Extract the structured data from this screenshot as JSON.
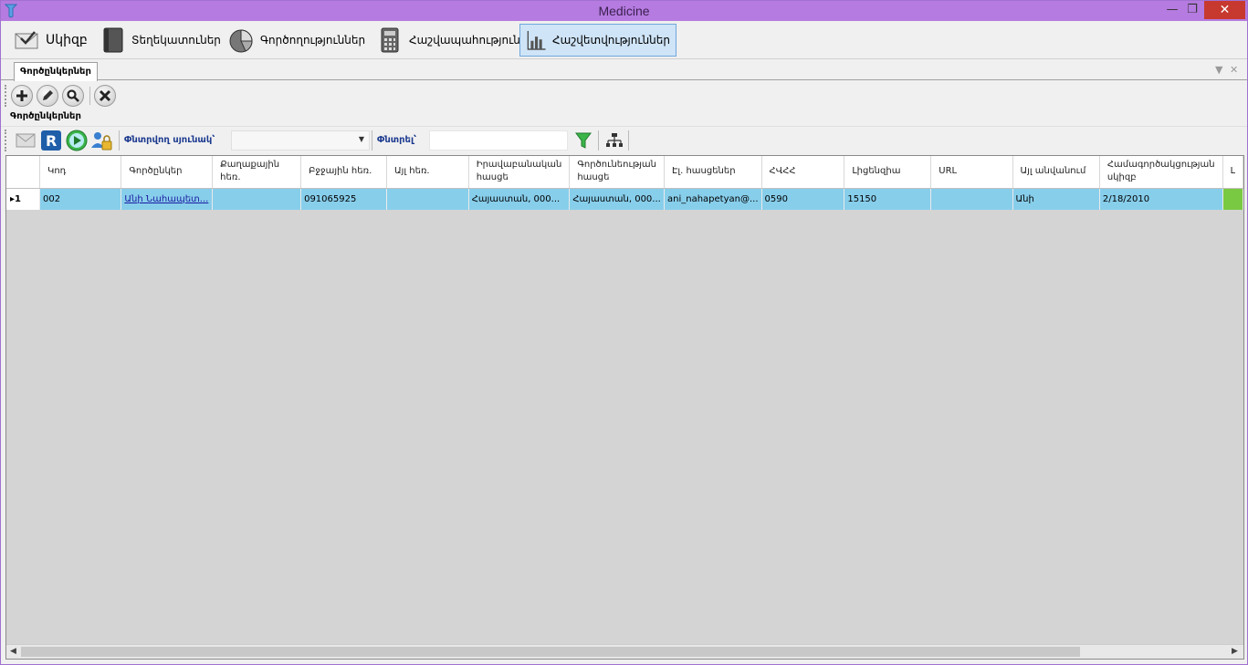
{
  "window": {
    "title": "Medicine"
  },
  "main_menu": [
    {
      "label": "Սկիզբ",
      "icon": "envelope-check-icon"
    },
    {
      "label": "Տեղեկատուներ",
      "icon": "binder-icon"
    },
    {
      "label": "Գործողություններ",
      "icon": "pie-chart-icon"
    },
    {
      "label": "Հաշվապահություն",
      "icon": "calculator-icon"
    },
    {
      "label": "Հաշվետվություններ",
      "icon": "bar-chart-icon",
      "active": true
    }
  ],
  "doc_tab": {
    "label": "Գործընկերներ"
  },
  "section": {
    "label": "Գործընկերներ"
  },
  "toolbar2": {
    "search_column_label": "Փնտրվող սյունակ՝",
    "search_column_value": "",
    "search_label": "Փնտրել՝",
    "search_value": ""
  },
  "grid": {
    "columns": [
      "Կոդ",
      "Գործընկեր",
      "Քաղաքային հեռ.",
      "Բջջային հեռ.",
      "Այլ հեռ.",
      "Իրավաբանական հասցե",
      "Գործունեության հասցե",
      "Էլ. հասցեներ",
      "ՀՎՀՀ",
      "Լիցենզիա",
      "URL",
      "Այլ անվանում",
      "Համագործակցության սկիզբ",
      "Լ"
    ],
    "rows": [
      {
        "marker": "▸1",
        "cells": [
          "002",
          "Անի Նահապետ...",
          "",
          "091065925",
          "",
          "Հայաստան, 000...",
          "Հայաստան, 000...",
          "ani_nahapetyan@...",
          "0590",
          "15150",
          "",
          "Անի",
          "2/18/2010",
          ""
        ]
      }
    ]
  },
  "colors": {
    "title_bar": "#b57be0",
    "selected_row": "#87ceeb",
    "active_menu": "#cfe4f7"
  }
}
